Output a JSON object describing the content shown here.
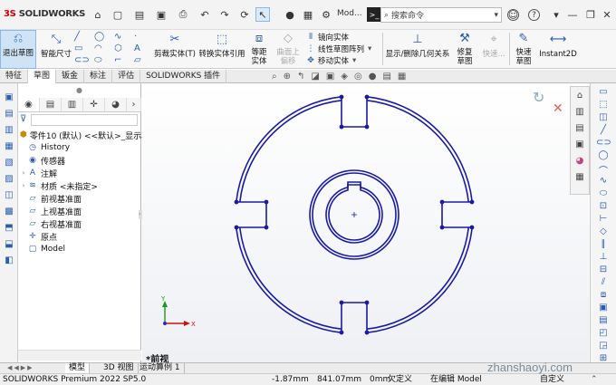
{
  "app": {
    "logo_text": "SOLIDWORKS",
    "logo_prefix": "3S"
  },
  "quick": {
    "mod_label": "Mod...",
    "search_placeholder": "搜索命令",
    "help_icon": "?"
  },
  "command": {
    "exit_sketch": "退出草图",
    "smart_dim": "智能尺寸",
    "trim": "剪裁实体(T)",
    "convert": "转换实体引用",
    "offset": "等距实体",
    "surface_offset": "曲面上偏移",
    "mirror": "镜向实体",
    "linear_pattern": "线性草图阵列",
    "move": "移动实体",
    "relations": "显示/删除几何关系",
    "repair": "修复草图",
    "quick_snap": "快速...",
    "rapid_sketch": "快速草图",
    "instant2d": "Instant2D"
  },
  "tabs": [
    "特征",
    "草图",
    "钣金",
    "标注",
    "评估",
    "SOLIDWORKS 插件"
  ],
  "active_tab": 1,
  "tree": {
    "root": "零件10 (默认) <<默认>_显示状",
    "items": [
      {
        "label": "History",
        "icon": "history-icon"
      },
      {
        "label": "传感器",
        "icon": "sensor-icon"
      },
      {
        "label": "注解",
        "icon": "annotation-icon"
      },
      {
        "label": "材质 <未指定>",
        "icon": "material-icon"
      },
      {
        "label": "前视基准面",
        "icon": "plane-icon"
      },
      {
        "label": "上视基准面",
        "icon": "plane-icon"
      },
      {
        "label": "右视基准面",
        "icon": "plane-icon"
      },
      {
        "label": "原点",
        "icon": "origin-icon"
      },
      {
        "label": "Model",
        "icon": "sketch-icon"
      }
    ]
  },
  "view": {
    "label": "*前视"
  },
  "bottom_tabs": [
    "模型",
    "3D 视图",
    "运动算例 1"
  ],
  "status": {
    "product": "SOLIDWORKS Premium 2022 SP5.0",
    "x": "-1.87mm",
    "y": "841.07mm",
    "z": "0mm",
    "state": "欠定义",
    "editing": "在编辑 Model",
    "custom": "自定义"
  },
  "watermark": "zhanshaoyi.com",
  "colors": {
    "sketch": "#1a1aa8",
    "accent": "#2a5db0"
  }
}
